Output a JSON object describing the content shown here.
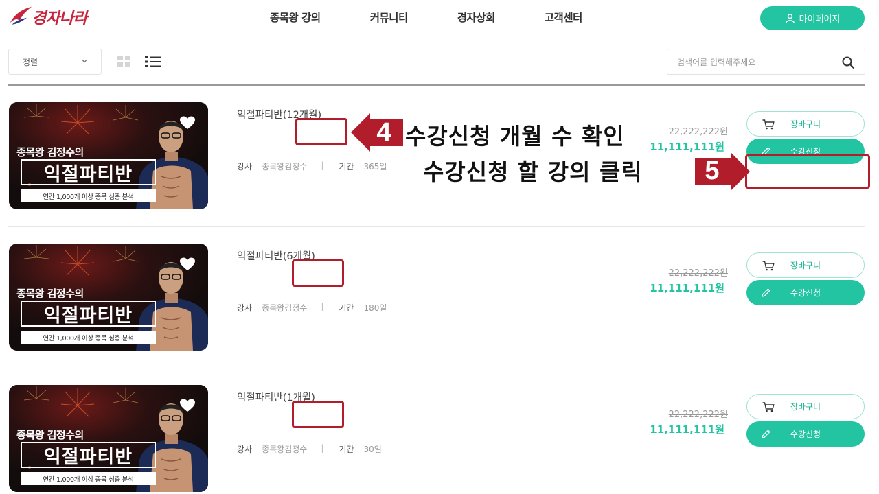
{
  "header": {
    "logo_text": "경자나라",
    "nav": [
      "종목왕 강의",
      "커뮤니티",
      "경자상회",
      "고객센터"
    ],
    "mypage_label": "마이페이지"
  },
  "toolbar": {
    "sort_label": "정렬",
    "search_placeholder": "검색어를 입력해주세요"
  },
  "courses": [
    {
      "title": "익절파티반(12개월)",
      "instructor_label": "강사",
      "instructor": "종목왕김정수",
      "period_label": "기간",
      "period": "365일",
      "price_old": "22,222,222원",
      "price_new": "11,111,111원",
      "cart_label": "장바구니",
      "enroll_label": "수강신청",
      "thumb": {
        "subtitle": "종목왕 김정수의",
        "main": "익절파티반",
        "bar": "연간 1,000개 이상 종목 심층 분석"
      }
    },
    {
      "title": "익절파티반(6개월)",
      "instructor_label": "강사",
      "instructor": "종목왕김정수",
      "period_label": "기간",
      "period": "180일",
      "price_old": "22,222,222원",
      "price_new": "11,111,111원",
      "cart_label": "장바구니",
      "enroll_label": "수강신청",
      "thumb": {
        "subtitle": "종목왕 김정수의",
        "main": "익절파티반",
        "bar": "연간 1,000개 이상 종목 심층 분석"
      }
    },
    {
      "title": "익절파티반(1개월)",
      "instructor_label": "강사",
      "instructor": "종목왕김정수",
      "period_label": "기간",
      "period": "30일",
      "price_old": "22,222,222원",
      "price_new": "11,111,111원",
      "cart_label": "장바구니",
      "enroll_label": "수강신청",
      "thumb": {
        "subtitle": "종목왕 김정수의",
        "main": "익절파티반",
        "bar": "연간 1,000개 이상 종목 심층 분석"
      }
    }
  ],
  "annotations": {
    "step4_number": "4",
    "step4_text": "수강신청 개월 수 확인",
    "step5_number": "5",
    "step5_text": "수강신청 할 강의 클릭"
  },
  "colors": {
    "accent": "#23c4a2",
    "brand": "#c8243c",
    "annotation": "#b21d2c"
  }
}
